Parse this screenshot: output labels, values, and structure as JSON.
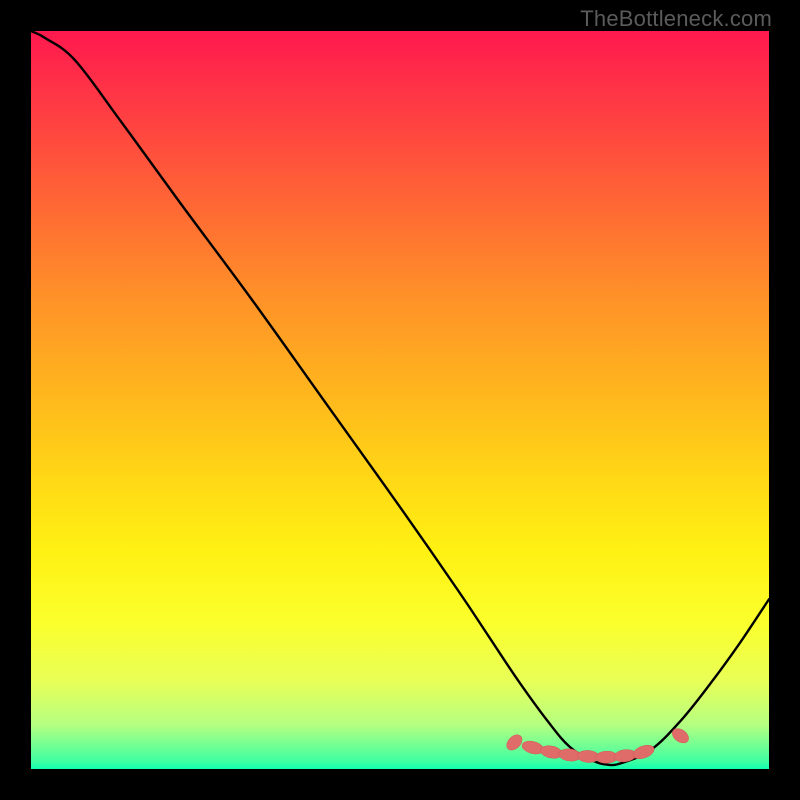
{
  "watermark": "TheBottleneck.com",
  "colors": {
    "curve": "#000000",
    "marker_fill": "#e06c69",
    "marker_stroke": "#d05a58",
    "background_black": "#000000"
  },
  "chart_data": {
    "type": "line",
    "title": "",
    "xlabel": "",
    "ylabel": "",
    "xlim": [
      0,
      100
    ],
    "ylim": [
      0,
      100
    ],
    "grid": false,
    "legend": false,
    "series": [
      {
        "name": "bottleneck-curve",
        "x": [
          0,
          2,
          6,
          12,
          20,
          30,
          40,
          50,
          58,
          62,
          66,
          70,
          73,
          76,
          78,
          80,
          84,
          88,
          92,
          96,
          100
        ],
        "values": [
          100,
          99,
          96,
          88,
          77,
          63.5,
          49.5,
          35.5,
          24,
          18,
          12,
          6.5,
          3,
          1.2,
          0.6,
          0.8,
          2.6,
          6.5,
          11.5,
          17,
          23
        ]
      }
    ],
    "markers": {
      "name": "optimal-zone-dots",
      "x": [
        65.5,
        68,
        70.5,
        73,
        75.5,
        78,
        80.5,
        83,
        88
      ],
      "y": [
        3.6,
        2.9,
        2.3,
        1.9,
        1.7,
        1.6,
        1.8,
        2.3,
        4.5
      ]
    }
  }
}
